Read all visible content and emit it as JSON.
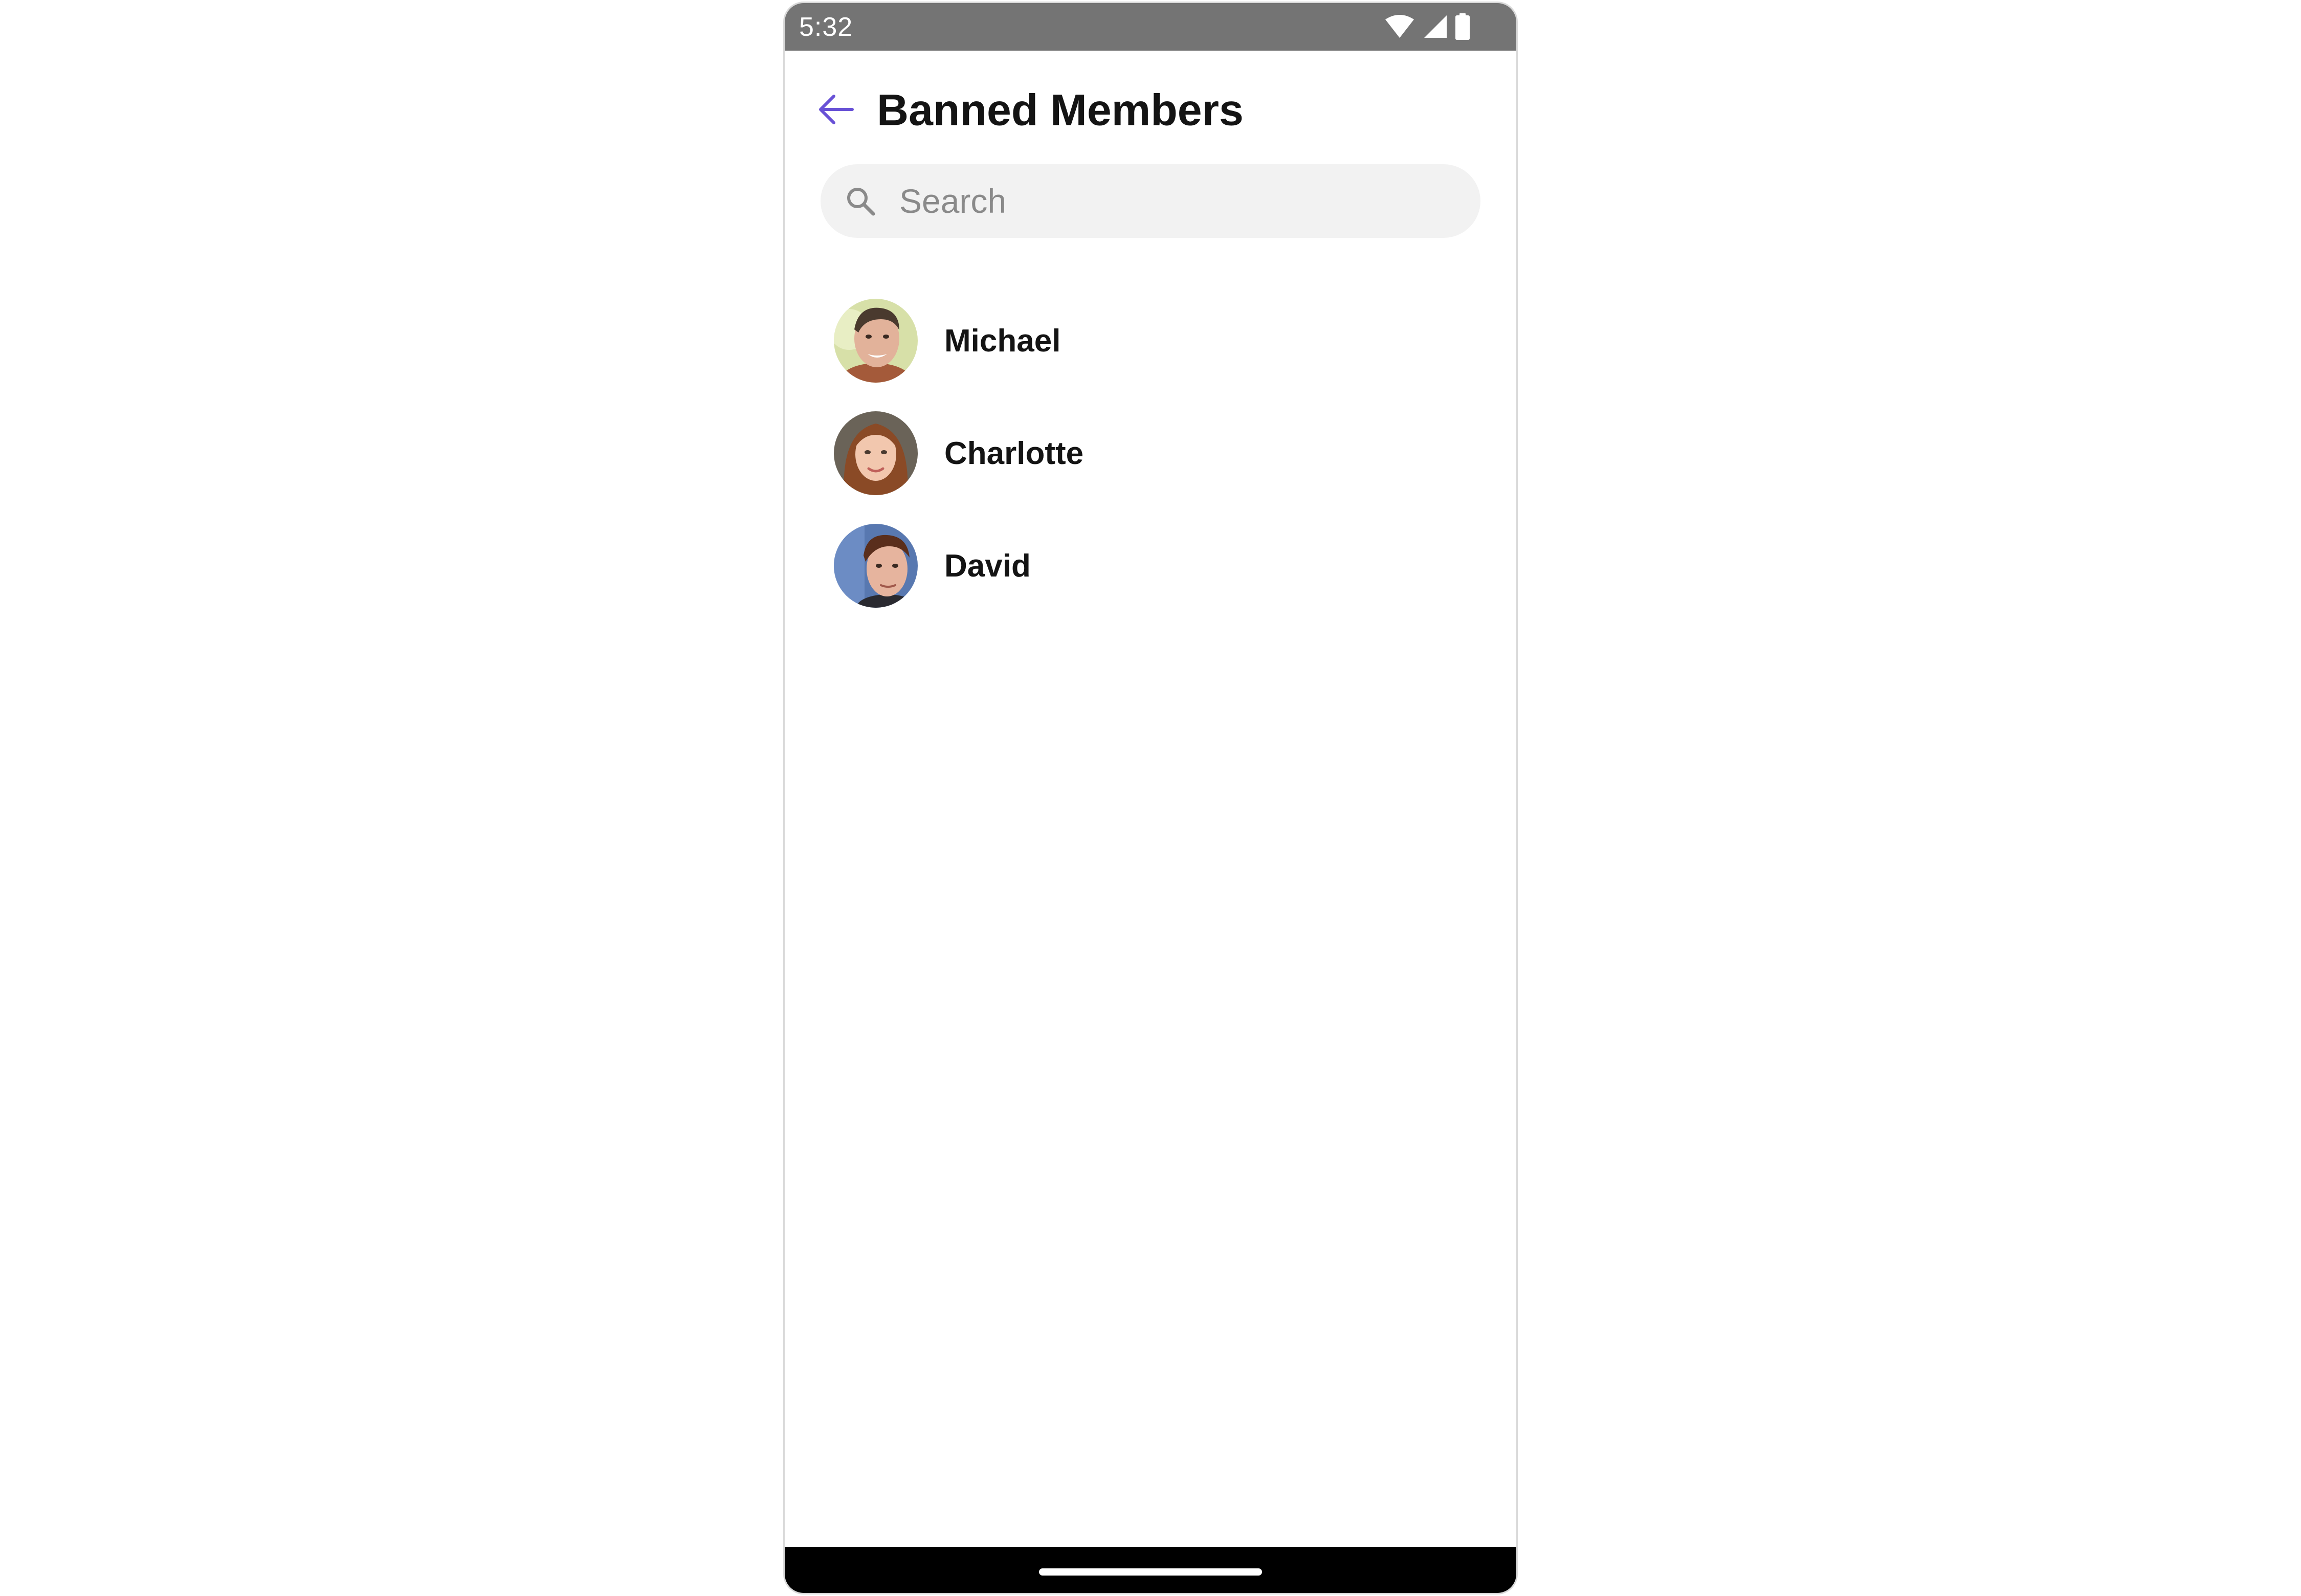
{
  "status_bar": {
    "time": "5:32",
    "icons": [
      "wifi-icon",
      "cellular-signal-icon",
      "battery-icon"
    ],
    "background": "#747474"
  },
  "header": {
    "title": "Banned Members",
    "back_icon": "arrow-left-icon",
    "accent_color": "#6851d6"
  },
  "search": {
    "placeholder": "Search",
    "icon": "search-icon"
  },
  "members": [
    {
      "name": "Michael",
      "avatar": "avatar-michael"
    },
    {
      "name": "Charlotte",
      "avatar": "avatar-charlotte"
    },
    {
      "name": "David",
      "avatar": "avatar-david"
    }
  ]
}
